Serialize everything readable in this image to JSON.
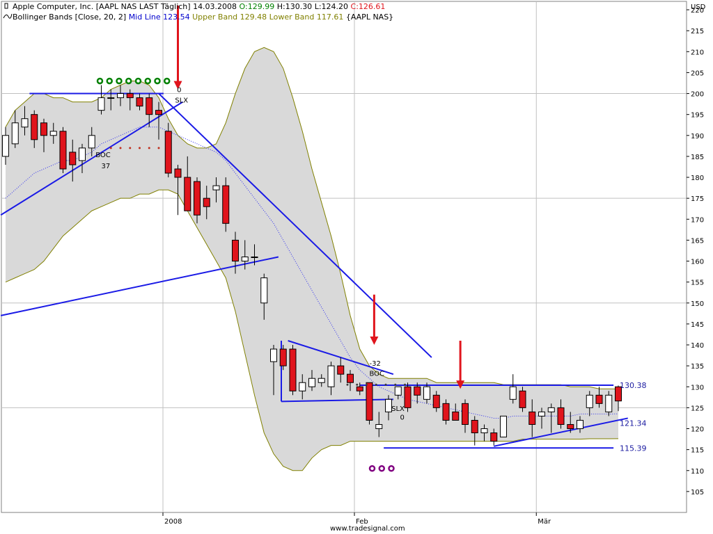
{
  "header": {
    "title": "Apple Computer, Inc. [AAPL NAS LAST Täglich] 14.03.2008",
    "open": "O:129.99",
    "high": "H:130.30",
    "low": "L:124.20",
    "close": "C:126.61",
    "indicator_name": "Bollinger Bands [Close, 20, 2]",
    "mid_line": "Mid Line 123.54",
    "upper_band": "Upper Band 129.48",
    "lower_band": "Lower Band 117.61",
    "symbol": "{AAPL NAS}"
  },
  "currency_label": "USD",
  "watermark": "www.tradesignal.com",
  "colors": {
    "up_candle": "#ffffff",
    "down_candle": "#e0141c",
    "band_fill": "#d9d9d9",
    "band_line": "#808000",
    "mid_line": "#2a2af0",
    "trend_line": "#1a1ae6",
    "arrow": "#e0141c",
    "open_text": "#008000",
    "close_text": "#e0141c",
    "mid_text": "#0000cc",
    "upper_text": "#808000"
  },
  "annotations": {
    "boc_top": "BOC",
    "boc_top_value": "37",
    "slx_top": "SLX",
    "slx_top_value": "0",
    "boc_feb": "BOC",
    "boc_feb_value": "-32",
    "slx_feb": "SLX",
    "slx_feb_value": "0"
  },
  "chart_data": {
    "type": "candlestick",
    "title": "Apple Computer, Inc. [AAPL NAS LAST Täglich] 14.03.2008",
    "ylabel": "USD",
    "ylim": [
      100,
      222
    ],
    "y_ticks": [
      105,
      110,
      115,
      120,
      125,
      130,
      135,
      140,
      145,
      150,
      155,
      160,
      165,
      170,
      175,
      180,
      185,
      190,
      195,
      200,
      205,
      210,
      215,
      220
    ],
    "x_ticks": [
      {
        "label": "2008",
        "index": 16
      },
      {
        "label": "Feb",
        "index": 36
      },
      {
        "label": "Mär",
        "index": 55
      }
    ],
    "grid": true,
    "candles": [
      {
        "o": 185,
        "h": 192,
        "l": 183,
        "c": 190
      },
      {
        "o": 188,
        "h": 196,
        "l": 187,
        "c": 193
      },
      {
        "o": 192,
        "h": 197,
        "l": 190,
        "c": 194
      },
      {
        "o": 195,
        "h": 196,
        "l": 187,
        "c": 189
      },
      {
        "o": 193,
        "h": 194,
        "l": 186,
        "c": 190
      },
      {
        "o": 190,
        "h": 193,
        "l": 188,
        "c": 191
      },
      {
        "o": 191,
        "h": 192,
        "l": 181,
        "c": 182
      },
      {
        "o": 186,
        "h": 189,
        "l": 179,
        "c": 183
      },
      {
        "o": 184,
        "h": 188,
        "l": 181,
        "c": 187
      },
      {
        "o": 187,
        "h": 192,
        "l": 185,
        "c": 190
      },
      {
        "o": 196,
        "h": 202,
        "l": 195,
        "c": 199
      },
      {
        "o": 199,
        "h": 201,
        "l": 196,
        "c": 199
      },
      {
        "o": 199,
        "h": 202,
        "l": 197,
        "c": 200
      },
      {
        "o": 200,
        "h": 201,
        "l": 196,
        "c": 199
      },
      {
        "o": 199,
        "h": 200,
        "l": 196,
        "c": 197
      },
      {
        "o": 199,
        "h": 200,
        "l": 192,
        "c": 195
      },
      {
        "o": 196,
        "h": 198,
        "l": 189,
        "c": 195
      },
      {
        "o": 191,
        "h": 193,
        "l": 180,
        "c": 181
      },
      {
        "o": 182,
        "h": 183,
        "l": 171,
        "c": 180
      },
      {
        "o": 180,
        "h": 185,
        "l": 172,
        "c": 172
      },
      {
        "o": 179,
        "h": 180,
        "l": 169,
        "c": 171
      },
      {
        "o": 175,
        "h": 178,
        "l": 170,
        "c": 173
      },
      {
        "o": 177,
        "h": 180,
        "l": 174,
        "c": 178
      },
      {
        "o": 178,
        "h": 180,
        "l": 167,
        "c": 169
      },
      {
        "o": 165,
        "h": 167,
        "l": 157,
        "c": 160
      },
      {
        "o": 160,
        "h": 165,
        "l": 158,
        "c": 161
      },
      {
        "o": 161,
        "h": 164,
        "l": 159,
        "c": 161
      },
      {
        "o": 150,
        "h": 157,
        "l": 146,
        "c": 156
      },
      {
        "o": 136,
        "h": 140,
        "l": 128,
        "c": 139
      },
      {
        "o": 139,
        "h": 140,
        "l": 134,
        "c": 135
      },
      {
        "o": 139,
        "h": 140,
        "l": 128,
        "c": 129
      },
      {
        "o": 129,
        "h": 133,
        "l": 127,
        "c": 131
      },
      {
        "o": 130,
        "h": 134,
        "l": 129,
        "c": 132
      },
      {
        "o": 131,
        "h": 133,
        "l": 130,
        "c": 132
      },
      {
        "o": 130,
        "h": 136,
        "l": 128,
        "c": 135
      },
      {
        "o": 135,
        "h": 137,
        "l": 131,
        "c": 133
      },
      {
        "o": 133,
        "h": 134,
        "l": 129,
        "c": 131
      },
      {
        "o": 130,
        "h": 131,
        "l": 128,
        "c": 129
      },
      {
        "o": 131,
        "h": 131,
        "l": 121,
        "c": 122
      },
      {
        "o": 120,
        "h": 124,
        "l": 118,
        "c": 121
      },
      {
        "o": 124,
        "h": 128,
        "l": 122,
        "c": 127
      },
      {
        "o": 128,
        "h": 130,
        "l": 127,
        "c": 130
      },
      {
        "o": 130,
        "h": 131,
        "l": 124,
        "c": 125
      },
      {
        "o": 130,
        "h": 131,
        "l": 126,
        "c": 128
      },
      {
        "o": 127,
        "h": 131,
        "l": 126,
        "c": 130
      },
      {
        "o": 128,
        "h": 129,
        "l": 124,
        "c": 125
      },
      {
        "o": 126,
        "h": 127,
        "l": 121,
        "c": 122
      },
      {
        "o": 124,
        "h": 126,
        "l": 122,
        "c": 122
      },
      {
        "o": 126,
        "h": 127,
        "l": 119,
        "c": 121
      },
      {
        "o": 122,
        "h": 123,
        "l": 116,
        "c": 119
      },
      {
        "o": 119,
        "h": 121,
        "l": 117,
        "c": 120
      },
      {
        "o": 119,
        "h": 120,
        "l": 116,
        "c": 117
      },
      {
        "o": 118,
        "h": 123,
        "l": 118,
        "c": 123
      },
      {
        "o": 127,
        "h": 133,
        "l": 126,
        "c": 130
      },
      {
        "o": 129,
        "h": 130,
        "l": 124,
        "c": 125
      },
      {
        "o": 124,
        "h": 127,
        "l": 118,
        "c": 121
      },
      {
        "o": 123,
        "h": 125,
        "l": 120,
        "c": 124
      },
      {
        "o": 124,
        "h": 126,
        "l": 119,
        "c": 125
      },
      {
        "o": 125,
        "h": 127,
        "l": 120,
        "c": 121
      },
      {
        "o": 121,
        "h": 124,
        "l": 119,
        "c": 120
      },
      {
        "o": 120,
        "h": 123,
        "l": 119,
        "c": 122
      },
      {
        "o": 125,
        "h": 129,
        "l": 123,
        "c": 128
      },
      {
        "o": 128,
        "h": 130,
        "l": 125,
        "c": 126
      },
      {
        "o": 124,
        "h": 129,
        "l": 123,
        "c": 128
      },
      {
        "o": 130,
        "h": 130.3,
        "l": 124.2,
        "c": 126.61
      }
    ],
    "bollinger": {
      "upper": [
        192,
        196,
        198,
        200,
        200,
        199,
        199,
        198,
        198,
        198,
        199,
        201,
        202,
        203,
        203,
        202,
        199,
        194,
        190,
        188,
        187,
        187,
        188,
        193,
        200,
        206,
        210,
        211,
        210,
        206,
        199,
        191,
        182,
        174,
        166,
        157,
        147,
        139,
        135,
        133,
        132,
        132,
        132,
        132,
        132,
        131,
        131,
        131,
        131,
        131,
        131,
        131,
        130.5,
        130.5,
        130.5,
        130.5,
        130.5,
        130.5,
        130.5,
        130,
        130,
        130,
        129.5,
        129.5,
        129.48
      ],
      "mid": [
        175,
        177,
        179,
        181,
        182,
        183,
        184,
        184,
        185,
        186,
        188,
        189,
        190,
        191,
        192,
        192,
        192,
        191,
        190,
        189,
        188,
        187,
        186,
        184,
        181,
        178,
        175,
        172,
        169,
        165,
        161,
        157,
        153,
        149,
        145,
        141,
        137,
        134,
        132,
        130,
        129,
        128,
        127,
        126.5,
        126,
        125.5,
        125,
        124.5,
        124,
        123.5,
        123,
        122.5,
        122.5,
        123,
        123,
        123,
        123,
        123,
        123,
        123,
        123.5,
        123.5,
        123.5,
        123.5,
        123.54
      ],
      "lower": [
        155,
        156,
        157,
        158,
        160,
        163,
        166,
        168,
        170,
        172,
        173,
        174,
        175,
        175,
        176,
        176,
        177,
        177,
        176,
        172,
        168,
        164,
        160,
        156,
        148,
        138,
        128,
        119,
        114,
        111,
        110,
        110,
        113,
        115,
        116,
        116,
        117,
        117,
        117,
        117,
        117,
        117,
        117,
        117,
        117,
        117,
        117,
        117,
        117,
        117,
        117,
        117,
        117,
        117,
        117.5,
        117.5,
        117.5,
        117.5,
        117.5,
        117.5,
        117.5,
        117.6,
        117.6,
        117.6,
        117.61
      ]
    },
    "levels": [
      {
        "label": "130.38",
        "value": 130.38
      },
      {
        "label": "121.34",
        "value": 121.34
      },
      {
        "label": "115.39",
        "value": 115.39
      }
    ],
    "trend_lines": [
      {
        "from": {
          "i": -0.5,
          "v": 171
        },
        "to": {
          "i": 18.5,
          "v": 198
        }
      },
      {
        "from": {
          "i": -0.5,
          "v": 147
        },
        "to": {
          "i": 28.5,
          "v": 161
        }
      },
      {
        "from": {
          "i": 2.5,
          "v": 200
        },
        "to": {
          "i": 16.5,
          "v": 200
        }
      },
      {
        "from": {
          "i": 16.0,
          "v": 200
        },
        "to": {
          "i": 44.5,
          "v": 137
        }
      },
      {
        "from": {
          "i": 29.5,
          "v": 141
        },
        "to": {
          "i": 40.5,
          "v": 133
        }
      },
      {
        "from": {
          "i": 28.8,
          "v": 141
        },
        "to": {
          "i": 28.8,
          "v": 126.5
        }
      },
      {
        "from": {
          "i": 28.8,
          "v": 126.5
        },
        "to": {
          "i": 40.5,
          "v": 127
        }
      },
      {
        "from": {
          "i": 37.0,
          "v": 130.38
        },
        "to": {
          "i": 63.5,
          "v": 130.38
        }
      },
      {
        "from": {
          "i": 39.5,
          "v": 115.39
        },
        "to": {
          "i": 63.5,
          "v": 115.39
        }
      },
      {
        "from": {
          "i": 51.0,
          "v": 115.8
        },
        "to": {
          "i": 65.0,
          "v": 122.5
        }
      }
    ],
    "arrows": [
      {
        "i": 18.0,
        "top": 221,
        "bottom": 201
      },
      {
        "i": 38.5,
        "top": 152,
        "bottom": 140
      },
      {
        "i": 47.5,
        "top": 141,
        "bottom": 129.5
      }
    ],
    "markers": {
      "green_circles": {
        "from_i": 10,
        "to_i": 17,
        "v": 203
      },
      "purple_circles": {
        "from_i": 38,
        "to_i": 40,
        "v": 110.5
      },
      "red_dots": {
        "from_i": 11,
        "to_i": 16,
        "v": 187
      },
      "dark_dots": {
        "from_i": 36,
        "to_i": 42,
        "v": 130.5
      }
    }
  }
}
